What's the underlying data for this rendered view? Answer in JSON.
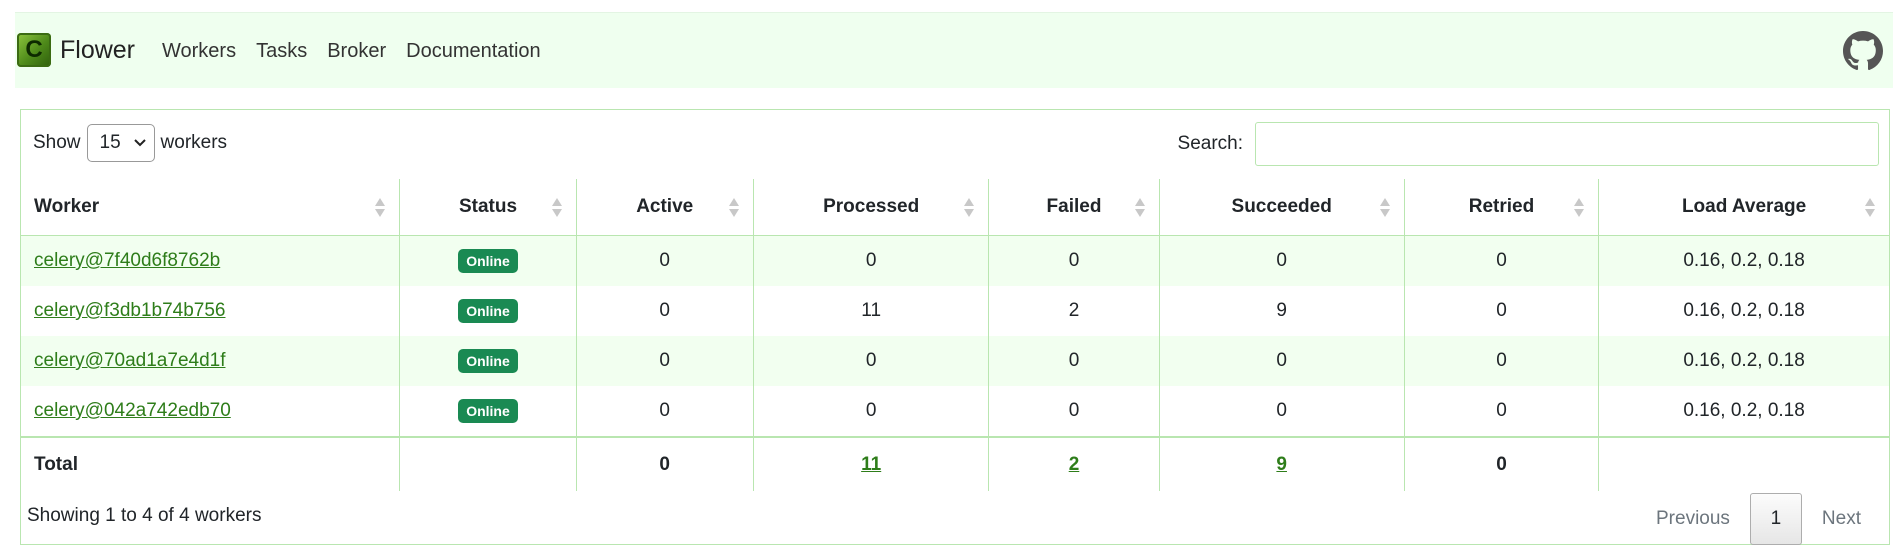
{
  "navbar": {
    "brand": "Flower",
    "logo_letter": "C",
    "links": [
      "Workers",
      "Tasks",
      "Broker",
      "Documentation"
    ],
    "github_icon": "github-icon"
  },
  "controls": {
    "show_label": "Show",
    "page_size": "15",
    "workers_label": "workers",
    "search_label": "Search:",
    "search_value": ""
  },
  "table": {
    "headers": [
      "Worker",
      "Status",
      "Active",
      "Processed",
      "Failed",
      "Succeeded",
      "Retried",
      "Load Average"
    ],
    "rows": [
      {
        "worker": "celery@7f40d6f8762b",
        "status": "Online",
        "active": "0",
        "processed": "0",
        "failed": "0",
        "succeeded": "0",
        "retried": "0",
        "load": "0.16, 0.2, 0.18"
      },
      {
        "worker": "celery@f3db1b74b756",
        "status": "Online",
        "active": "0",
        "processed": "11",
        "failed": "2",
        "succeeded": "9",
        "retried": "0",
        "load": "0.16, 0.2, 0.18"
      },
      {
        "worker": "celery@70ad1a7e4d1f",
        "status": "Online",
        "active": "0",
        "processed": "0",
        "failed": "0",
        "succeeded": "0",
        "retried": "0",
        "load": "0.16, 0.2, 0.18"
      },
      {
        "worker": "celery@042a742edb70",
        "status": "Online",
        "active": "0",
        "processed": "0",
        "failed": "0",
        "succeeded": "0",
        "retried": "0",
        "load": "0.16, 0.2, 0.18"
      }
    ],
    "total": {
      "label": "Total",
      "active": "0",
      "processed": "11",
      "failed": "2",
      "succeeded": "9",
      "retried": "0"
    }
  },
  "footer": {
    "info": "Showing 1 to 4 of 4 workers",
    "previous": "Previous",
    "page": "1",
    "next": "Next"
  },
  "colors": {
    "navbar_bg": "#efffef",
    "link": "#2e7d1a",
    "badge": "#1a8a53",
    "border": "#b9e6b0"
  }
}
